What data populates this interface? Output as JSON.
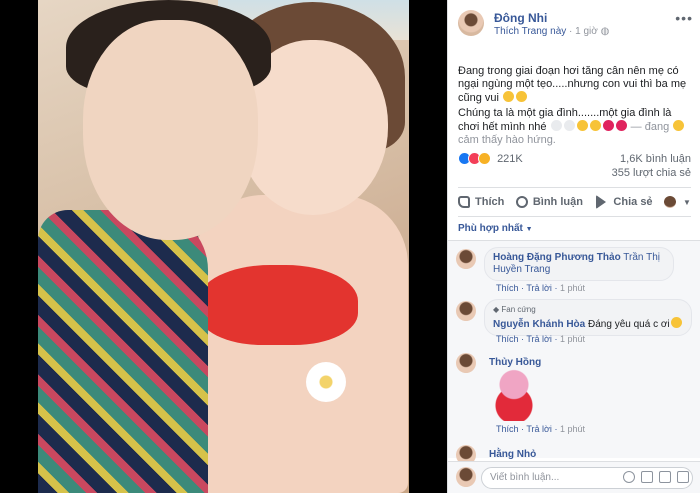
{
  "post": {
    "page_name": "Đông Nhi",
    "like_page": "Thích Trang này",
    "time": "1 giờ",
    "more": "•••",
    "text_line1": "Đang trong giai đoạn hơi tăng cân nên mẹ có ngại ngùng một tẹo.....nhưng con vui thì ba mẹ cũng vui",
    "text_line2": "Chúng ta là một gia đình.......một gia đình là chơi hết mình nhé",
    "feeling_prefix": "— đang",
    "feeling_text": "cảm thấy hào hứng."
  },
  "reactions": {
    "count": "221K",
    "comments": "1,6K bình luận",
    "shares": "355 lượt chia sẻ"
  },
  "actions": {
    "like": "Thích",
    "comment": "Bình luận",
    "share": "Chia sẻ"
  },
  "sort": {
    "label": "Phù hợp nhất"
  },
  "comments": [
    {
      "name": "Hoàng Đặng Phương Thảo",
      "text": "Trần Thị Huyền Trang",
      "like": "Thích",
      "reply": "Trả lời",
      "time": "1 phút"
    },
    {
      "badge": "Fan cứng",
      "name": "Nguyễn Khánh Hòa",
      "text": "Đáng yêu quá c ơi",
      "like": "Thích",
      "reply": "Trả lời",
      "time": "1 phút"
    },
    {
      "name": "Thủy Hồng",
      "text": "",
      "like": "Thích",
      "reply": "Trả lời",
      "time": "1 phút"
    },
    {
      "name": "Hằng Nhỏ"
    }
  ],
  "composer": {
    "placeholder": "Viết bình luận..."
  },
  "colors": {
    "link": "#385898",
    "like_blue": "#1877f2",
    "heart": "#f33e58"
  }
}
